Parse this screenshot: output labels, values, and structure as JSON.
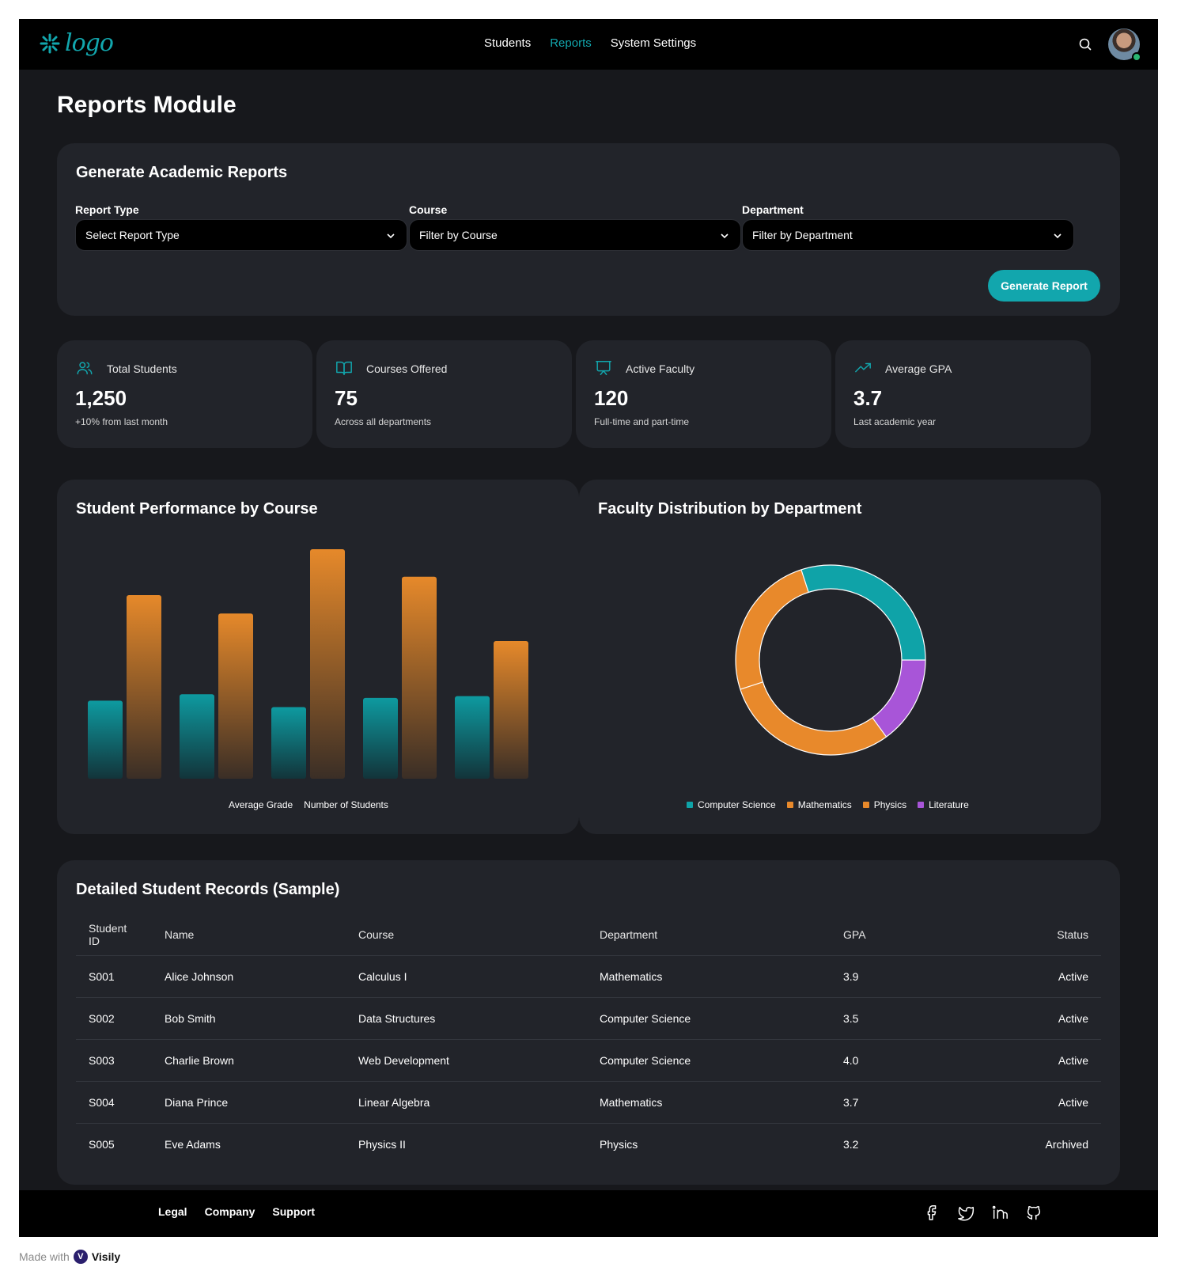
{
  "brand": {
    "logo_text": "logo",
    "accent": "#12a6ad"
  },
  "nav": {
    "items": [
      "Students",
      "Reports",
      "System Settings"
    ],
    "active": "Reports"
  },
  "page": {
    "title": "Reports Module"
  },
  "generate": {
    "title": "Generate Academic Reports",
    "fields": [
      {
        "label": "Report Type",
        "value": "Select Report Type"
      },
      {
        "label": "Course",
        "value": "Filter by Course"
      },
      {
        "label": "Department",
        "value": "Filter by Department"
      }
    ],
    "button": "Generate Report"
  },
  "stats": [
    {
      "icon": "users-icon",
      "label": "Total Students",
      "value": "1,250",
      "sub": "+10% from last month"
    },
    {
      "icon": "book-open-icon",
      "label": "Courses Offered",
      "value": "75",
      "sub": "Across all departments"
    },
    {
      "icon": "presentation-icon",
      "label": "Active Faculty",
      "value": "120",
      "sub": "Full-time and part-time"
    },
    {
      "icon": "trending-up-icon",
      "label": "Average GPA",
      "value": "3.7",
      "sub": "Last academic year"
    }
  ],
  "chart_data": [
    {
      "type": "bar",
      "title": "Student Performance by Course",
      "categories": [
        "",
        "",
        "",
        "",
        ""
      ],
      "series": [
        {
          "name": "Average Grade",
          "values": [
            85,
            92,
            78,
            88,
            90
          ],
          "color": "#0e9aa0"
        },
        {
          "name": "Number of Students",
          "values": [
            200,
            180,
            250,
            220,
            150
          ],
          "color": "#e6892a"
        }
      ],
      "grid": false,
      "legend": "bottom"
    },
    {
      "type": "pie",
      "title": "Faculty Distribution by Department",
      "labels": [
        "Computer Science",
        "Mathematics",
        "Physics",
        "Literature"
      ],
      "values": [
        30,
        25,
        30,
        15
      ],
      "colors": [
        "#0fa3a8",
        "#e8892b",
        "#e8892b",
        "#a855d8"
      ],
      "legend": "bottom"
    }
  ],
  "records": {
    "title": "Detailed Student Records (Sample)",
    "columns": [
      "Student ID",
      "Name",
      "Course",
      "Department",
      "GPA",
      "Status"
    ],
    "rows": [
      [
        "S001",
        "Alice Johnson",
        "Calculus I",
        "Mathematics",
        "3.9",
        "Active"
      ],
      [
        "S002",
        "Bob Smith",
        "Data Structures",
        "Computer Science",
        "3.5",
        "Active"
      ],
      [
        "S003",
        "Charlie Brown",
        "Web Development",
        "Computer Science",
        "4.0",
        "Active"
      ],
      [
        "S004",
        "Diana Prince",
        "Linear Algebra",
        "Mathematics",
        "3.7",
        "Active"
      ],
      [
        "S005",
        "Eve Adams",
        "Physics II",
        "Physics",
        "3.2",
        "Archived"
      ]
    ]
  },
  "footer": {
    "links": [
      "Legal",
      "Company",
      "Support"
    ],
    "social": [
      "facebook-icon",
      "twitter-icon",
      "linkedin-icon",
      "github-icon"
    ]
  },
  "watermark": {
    "prefix": "Made with",
    "brand": "Visily"
  }
}
